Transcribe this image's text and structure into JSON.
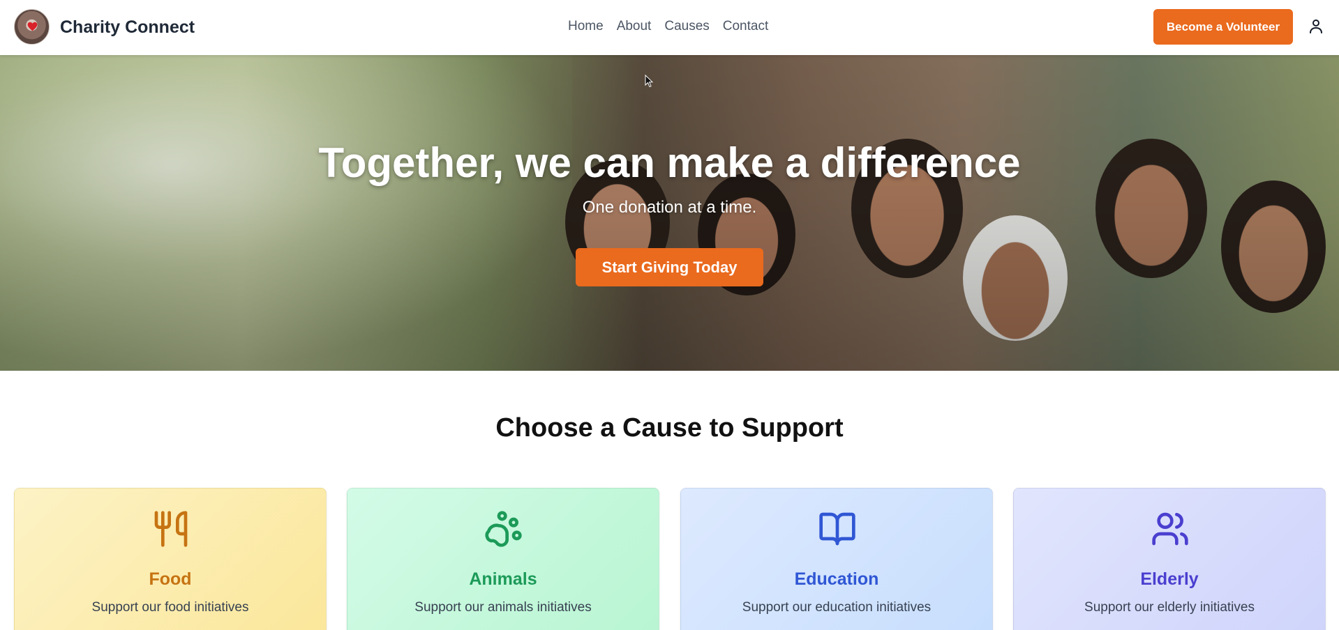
{
  "header": {
    "brand": "Charity Connect",
    "nav": [
      "Home",
      "About",
      "Causes",
      "Contact"
    ],
    "volunteer_label": "Become a Volunteer"
  },
  "hero": {
    "title": "Together, we can make a difference",
    "subtitle": "One donation at a time.",
    "cta_label": "Start Giving Today"
  },
  "causes": {
    "title": "Choose a Cause to Support",
    "items": [
      {
        "name": "Food",
        "description": "Support our food initiatives",
        "icon": "utensils-icon",
        "color": "#c67312"
      },
      {
        "name": "Animals",
        "description": "Support our animals initiatives",
        "icon": "paw-icon",
        "color": "#1c9a58"
      },
      {
        "name": "Education",
        "description": "Support our education initiatives",
        "icon": "book-open-icon",
        "color": "#2f56d4"
      },
      {
        "name": "Elderly",
        "description": "Support our elderly initiatives",
        "icon": "users-icon",
        "color": "#4a3fcf"
      }
    ]
  },
  "colors": {
    "accent": "#ea6a1e",
    "header_bg": "#ffffff"
  }
}
